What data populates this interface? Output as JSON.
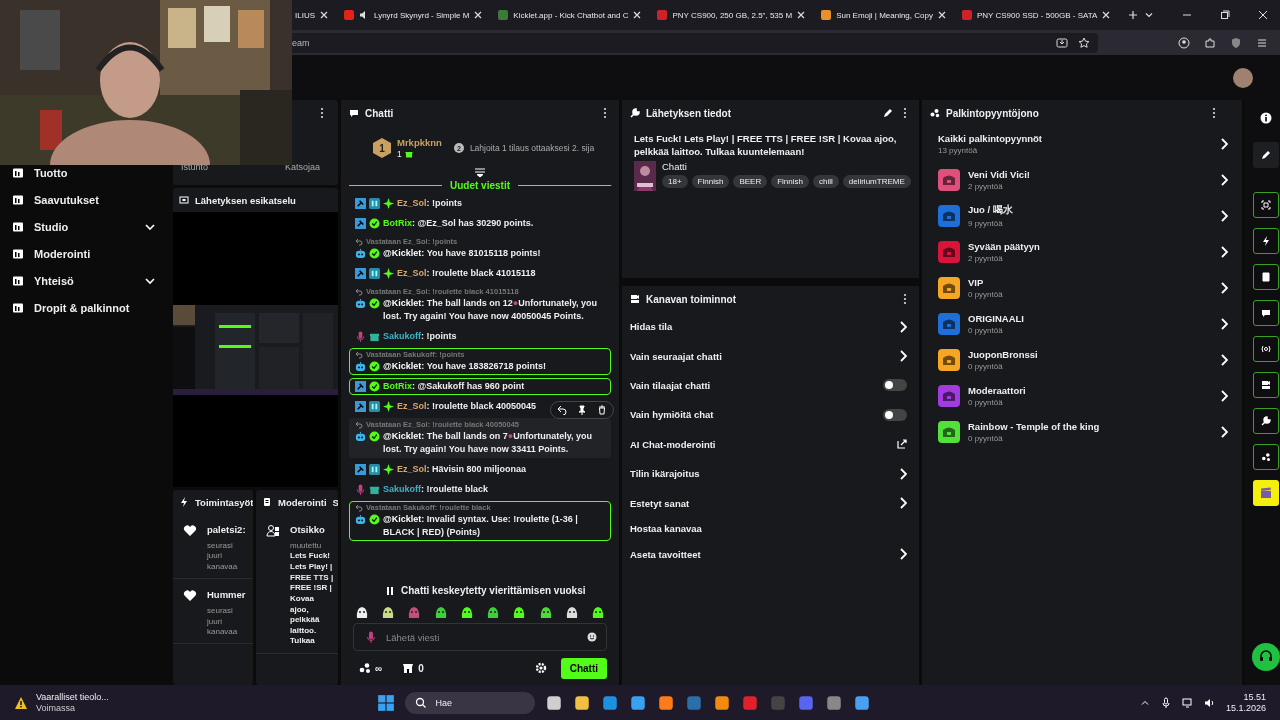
{
  "browser": {
    "tabs": [
      {
        "title": "ILIUS",
        "selected": false,
        "audio": false
      },
      {
        "title": "Lynyrd Skynyrd - Simple M",
        "selected": false,
        "audio": true
      },
      {
        "title": "Kicklet.app - Kick Chatbot and C",
        "selected": false,
        "audio": false
      },
      {
        "title": "PNY CS900, 250 GB, 2.5\", 535 M",
        "selected": false,
        "audio": false
      },
      {
        "title": "Sun Emoji | Meaning, Copy",
        "selected": false,
        "audio": false
      },
      {
        "title": "PNY CS900 SSD - 500GB - SATA",
        "selected": false,
        "audio": false
      }
    ],
    "address": "eam"
  },
  "nav": [
    {
      "label": "Tuotto",
      "expandable": false
    },
    {
      "label": "Saavutukset",
      "expandable": false
    },
    {
      "label": "Studio",
      "expandable": true
    },
    {
      "label": "Moderointi",
      "expandable": false
    },
    {
      "label": "Yhteisö",
      "expandable": true
    },
    {
      "label": "Dropit & palkinnot",
      "expandable": false
    }
  ],
  "stats": {
    "labels": [
      "Istunto",
      "Katsojaa"
    ]
  },
  "preview": {
    "title": "Lähetyksen esikatselu"
  },
  "activity": {
    "title": "Toimintasyöt",
    "items": [
      {
        "user": "paletsi2:",
        "text": "seurasi juuri kanavaa"
      },
      {
        "user": "Hummer",
        "text": "seurasi juuri kanavaa"
      }
    ]
  },
  "moderation": {
    "title": "Moderointi",
    "next_tab": "S",
    "entries": [
      {
        "title": "Otsikko",
        "action": "muutettu",
        "text": "Lets Fuck! Lets Play! | FREE TTS | FREE !SR | Kovaa ajoo, pelkkää laittoo. Tulkaa"
      }
    ]
  },
  "chat": {
    "title": "Chatti",
    "leader": {
      "rank": "1",
      "user": "Mrkpkknn",
      "count": "1"
    },
    "next_rank": {
      "rank": "2",
      "text": "Lahjoita 1 tilaus ottaaksesi 2. sija"
    },
    "divider": "Uudet viestit",
    "messages": [
      {
        "kind": "moderator",
        "user": "Ez_Sol",
        "color": "#d9a66b",
        "text": ": !points",
        "highlighted": false,
        "hovered": false
      },
      {
        "kind": "botrix",
        "user": "BotRix",
        "color": "#53fc18",
        "text": ": @Ez_Sol has 30290 points.",
        "highlighted": false,
        "hovered": false
      },
      {
        "kind": "bot",
        "reply": "Vastataan Ez_Sol: !points",
        "user": "@Kicklet",
        "color": "#ffffff",
        "text": ": You have 81015118 points!",
        "highlighted": false,
        "hovered": false
      },
      {
        "kind": "moderator",
        "user": "Ez_Sol",
        "color": "#d9a66b",
        "text": ": !roulette black 41015118",
        "highlighted": false,
        "hovered": false
      },
      {
        "kind": "bot",
        "reply": "Vastataan Ez_Sol: !roulette black 41015118",
        "user": "@Kicklet",
        "color": "#ffffff",
        "marker": "●",
        "text": ": The ball lands on 12",
        "text_after": "Unfortunately, you lost. Try again! You have now 40050045 Points.",
        "highlighted": false,
        "hovered": false
      },
      {
        "kind": "viewer",
        "user": "Sakukoff",
        "color": "#3ab4c9",
        "text": ": !points",
        "highlighted": false,
        "hovered": false
      },
      {
        "kind": "bot",
        "reply": "Vastataan Sakukoff: !points",
        "user": "@Kicklet",
        "color": "#ffffff",
        "text": ": You have 183826718 points!",
        "highlighted": true,
        "hovered": false
      },
      {
        "kind": "botrix",
        "user": "BotRix",
        "color": "#53fc18",
        "text": ": @Sakukoff has 960 point",
        "highlighted": true,
        "hovered": false
      },
      {
        "kind": "moderator",
        "user": "Ez_Sol",
        "color": "#d9a66b",
        "text": ": !roulette black 40050045",
        "highlighted": false,
        "hovered": false
      },
      {
        "kind": "bot",
        "reply": "Vastataan Ez_Sol: !roulette black 40050045",
        "user": "@Kicklet",
        "color": "#ffffff",
        "marker": "●",
        "text": ": The ball lands on 7",
        "text_after": "Unfortunately, you lost. Try again! You have now 33411 Points.",
        "highlighted": false,
        "hovered": true
      },
      {
        "kind": "moderator",
        "user": "Ez_Sol",
        "color": "#d9a66b",
        "text": ": Hävisin 800 miljoonaa",
        "highlighted": false,
        "hovered": false
      },
      {
        "kind": "viewer",
        "user": "Sakukoff",
        "color": "#3ab4c9",
        "text": ": !roulette black",
        "highlighted": false,
        "hovered": false
      },
      {
        "kind": "bot",
        "reply": "Vastataan Sakukoff: !roulette black",
        "user": "@Kicklet",
        "color": "#ffffff",
        "text": ": Invalid syntax. Use: !roulette (1-36 | BLACK | RED) (Points)",
        "highlighted": true,
        "hovered": false
      }
    ],
    "paused": "Chatti keskeytetty vierittämisen vuoksi",
    "placeholder": "Lähetä viesti",
    "points": "∞",
    "store_count": "0",
    "send": "Chatti"
  },
  "stream_info": {
    "title": "Lähetyksen tiedot",
    "stream_title": "Lets Fuck! Lets Play! | FREE TTS | FREE !SR | Kovaa ajoo, pelkkää laittoo. Tulkaa kuuntelemaan!",
    "category": "Chatti",
    "tags": [
      "18+",
      "Finnish",
      "BEER",
      "Finnish",
      "chill",
      "deliriumTREME"
    ]
  },
  "channel_actions": {
    "title": "Kanavan toiminnot",
    "items": [
      {
        "label": "Hidas tila",
        "kind": "link"
      },
      {
        "label": "Vain seuraajat chatti",
        "kind": "link"
      },
      {
        "label": "Vain tilaajat chatti",
        "kind": "toggle",
        "on": false
      },
      {
        "label": "Vain hymiöitä chat",
        "kind": "toggle",
        "on": false
      },
      {
        "label": "AI Chat-moderointi",
        "kind": "external"
      },
      {
        "label": "Tilin ikärajoitus",
        "kind": "link"
      },
      {
        "label": "Estetyt sanat",
        "kind": "link"
      },
      {
        "label": "Hostaa kanavaa",
        "kind": "plain"
      },
      {
        "label": "Aseta tavoitteet",
        "kind": "link"
      }
    ]
  },
  "rewards": {
    "title": "Palkintopyyntöjono",
    "all": {
      "label": "Kaikki palkintopyynnöt",
      "count": "13 pyyntöä"
    },
    "items": [
      {
        "name": "Veni Vidi Vici!",
        "count": "2 pyyntöä",
        "color": "#e0507c"
      },
      {
        "name": "Juo / 喝水",
        "count": "9 pyyntöä",
        "color": "#1e6fd9"
      },
      {
        "name": "Syvään päätyyn",
        "count": "2 pyyntöä",
        "color": "#d8143a"
      },
      {
        "name": "VIP",
        "count": "0 pyyntöä",
        "color": "#f5a623"
      },
      {
        "name": "ORIGINAALI",
        "count": "0 pyyntöä",
        "color": "#1e6fd9"
      },
      {
        "name": "JuoponBronssi",
        "count": "0 pyyntöä",
        "color": "#f5a623"
      },
      {
        "name": "Moderaattori",
        "count": "0 pyyntöä",
        "color": "#a23be0"
      },
      {
        "name": "Rainbow - Temple of the king",
        "count": "0 pyyntöä",
        "color": "#53e03a"
      }
    ]
  },
  "taskbar": {
    "alert_title": "Vaaralliset tieolo...",
    "alert_sub": "Voimassa",
    "search": "Hae",
    "time": "15.51",
    "date": "15.1.2026"
  }
}
